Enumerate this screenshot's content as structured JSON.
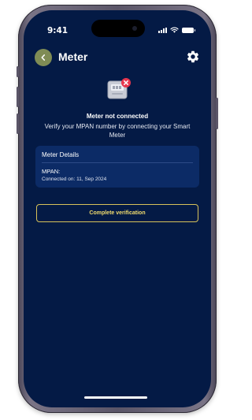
{
  "status_bar": {
    "time": "9:41",
    "icons": [
      "signal-icon",
      "wifi-icon",
      "battery-icon"
    ]
  },
  "header": {
    "title": "Meter",
    "back_icon": "chevron-left-icon",
    "settings_icon": "gear-icon"
  },
  "meter_status": {
    "illustration_icon": "meter-disconnected-icon",
    "heading": "Meter not connected",
    "message": "Verify your MPAN number by connecting your Smart Meter"
  },
  "meter_details": {
    "title": "Meter Details",
    "mpan_label": "MPAN:",
    "connected_on": "Connected on: 11, Sep 2024"
  },
  "actions": {
    "complete_verification": "Complete verification"
  },
  "colors": {
    "background": "#041a45",
    "card": "#0c2b66",
    "accent": "#d8c25a",
    "back_button": "#7f8c55",
    "error": "#e8384f"
  }
}
